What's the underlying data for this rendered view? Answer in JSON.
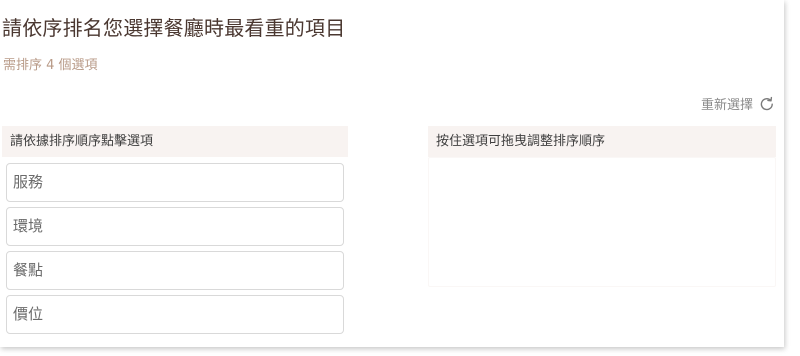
{
  "question": {
    "title": "請依序排名您選擇餐廳時最看重的項目",
    "hint": "需排序 4 個選項"
  },
  "reset": {
    "label": "重新選擇",
    "icon": "refresh-icon"
  },
  "left_panel": {
    "header": "請依據排序順序點擊選項",
    "options": [
      "服務",
      "環境",
      "餐點",
      "價位"
    ]
  },
  "right_panel": {
    "header": "按住選項可拖曳調整排序順序",
    "items": []
  },
  "colors": {
    "title": "#4a3730",
    "hint": "#b89a87",
    "panel_header_bg": "#f8f3f1",
    "option_border": "#d9d9d9"
  }
}
